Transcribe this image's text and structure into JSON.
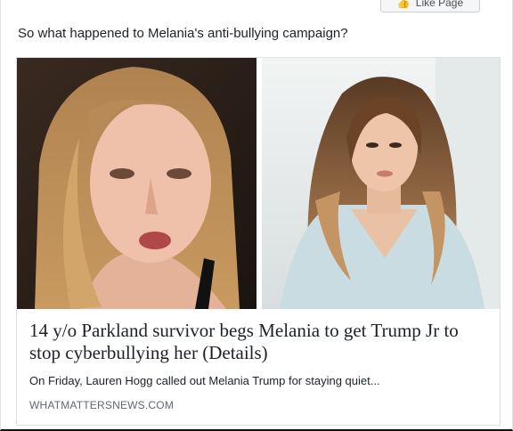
{
  "post": {
    "top_button_label": "Like Page",
    "status_text": "So what happened to Melania's anti-bullying campaign?"
  },
  "link_preview": {
    "images": [
      {
        "subject": "teen girl selfie",
        "icon": "photo-left"
      },
      {
        "subject": "woman in light blue dress",
        "icon": "photo-right"
      }
    ],
    "headline": "14 y/o Parkland survivor begs Melania to get Trump Jr to stop cyberbullying her (Details)",
    "description": "On Friday, Lauren Hogg called out Melania Trump for staying quiet...",
    "domain": "WHATMATTERSNEWS.COM"
  },
  "colors": {
    "text_primary": "#1d2129",
    "text_secondary": "#606770",
    "border": "#dddfe2"
  }
}
